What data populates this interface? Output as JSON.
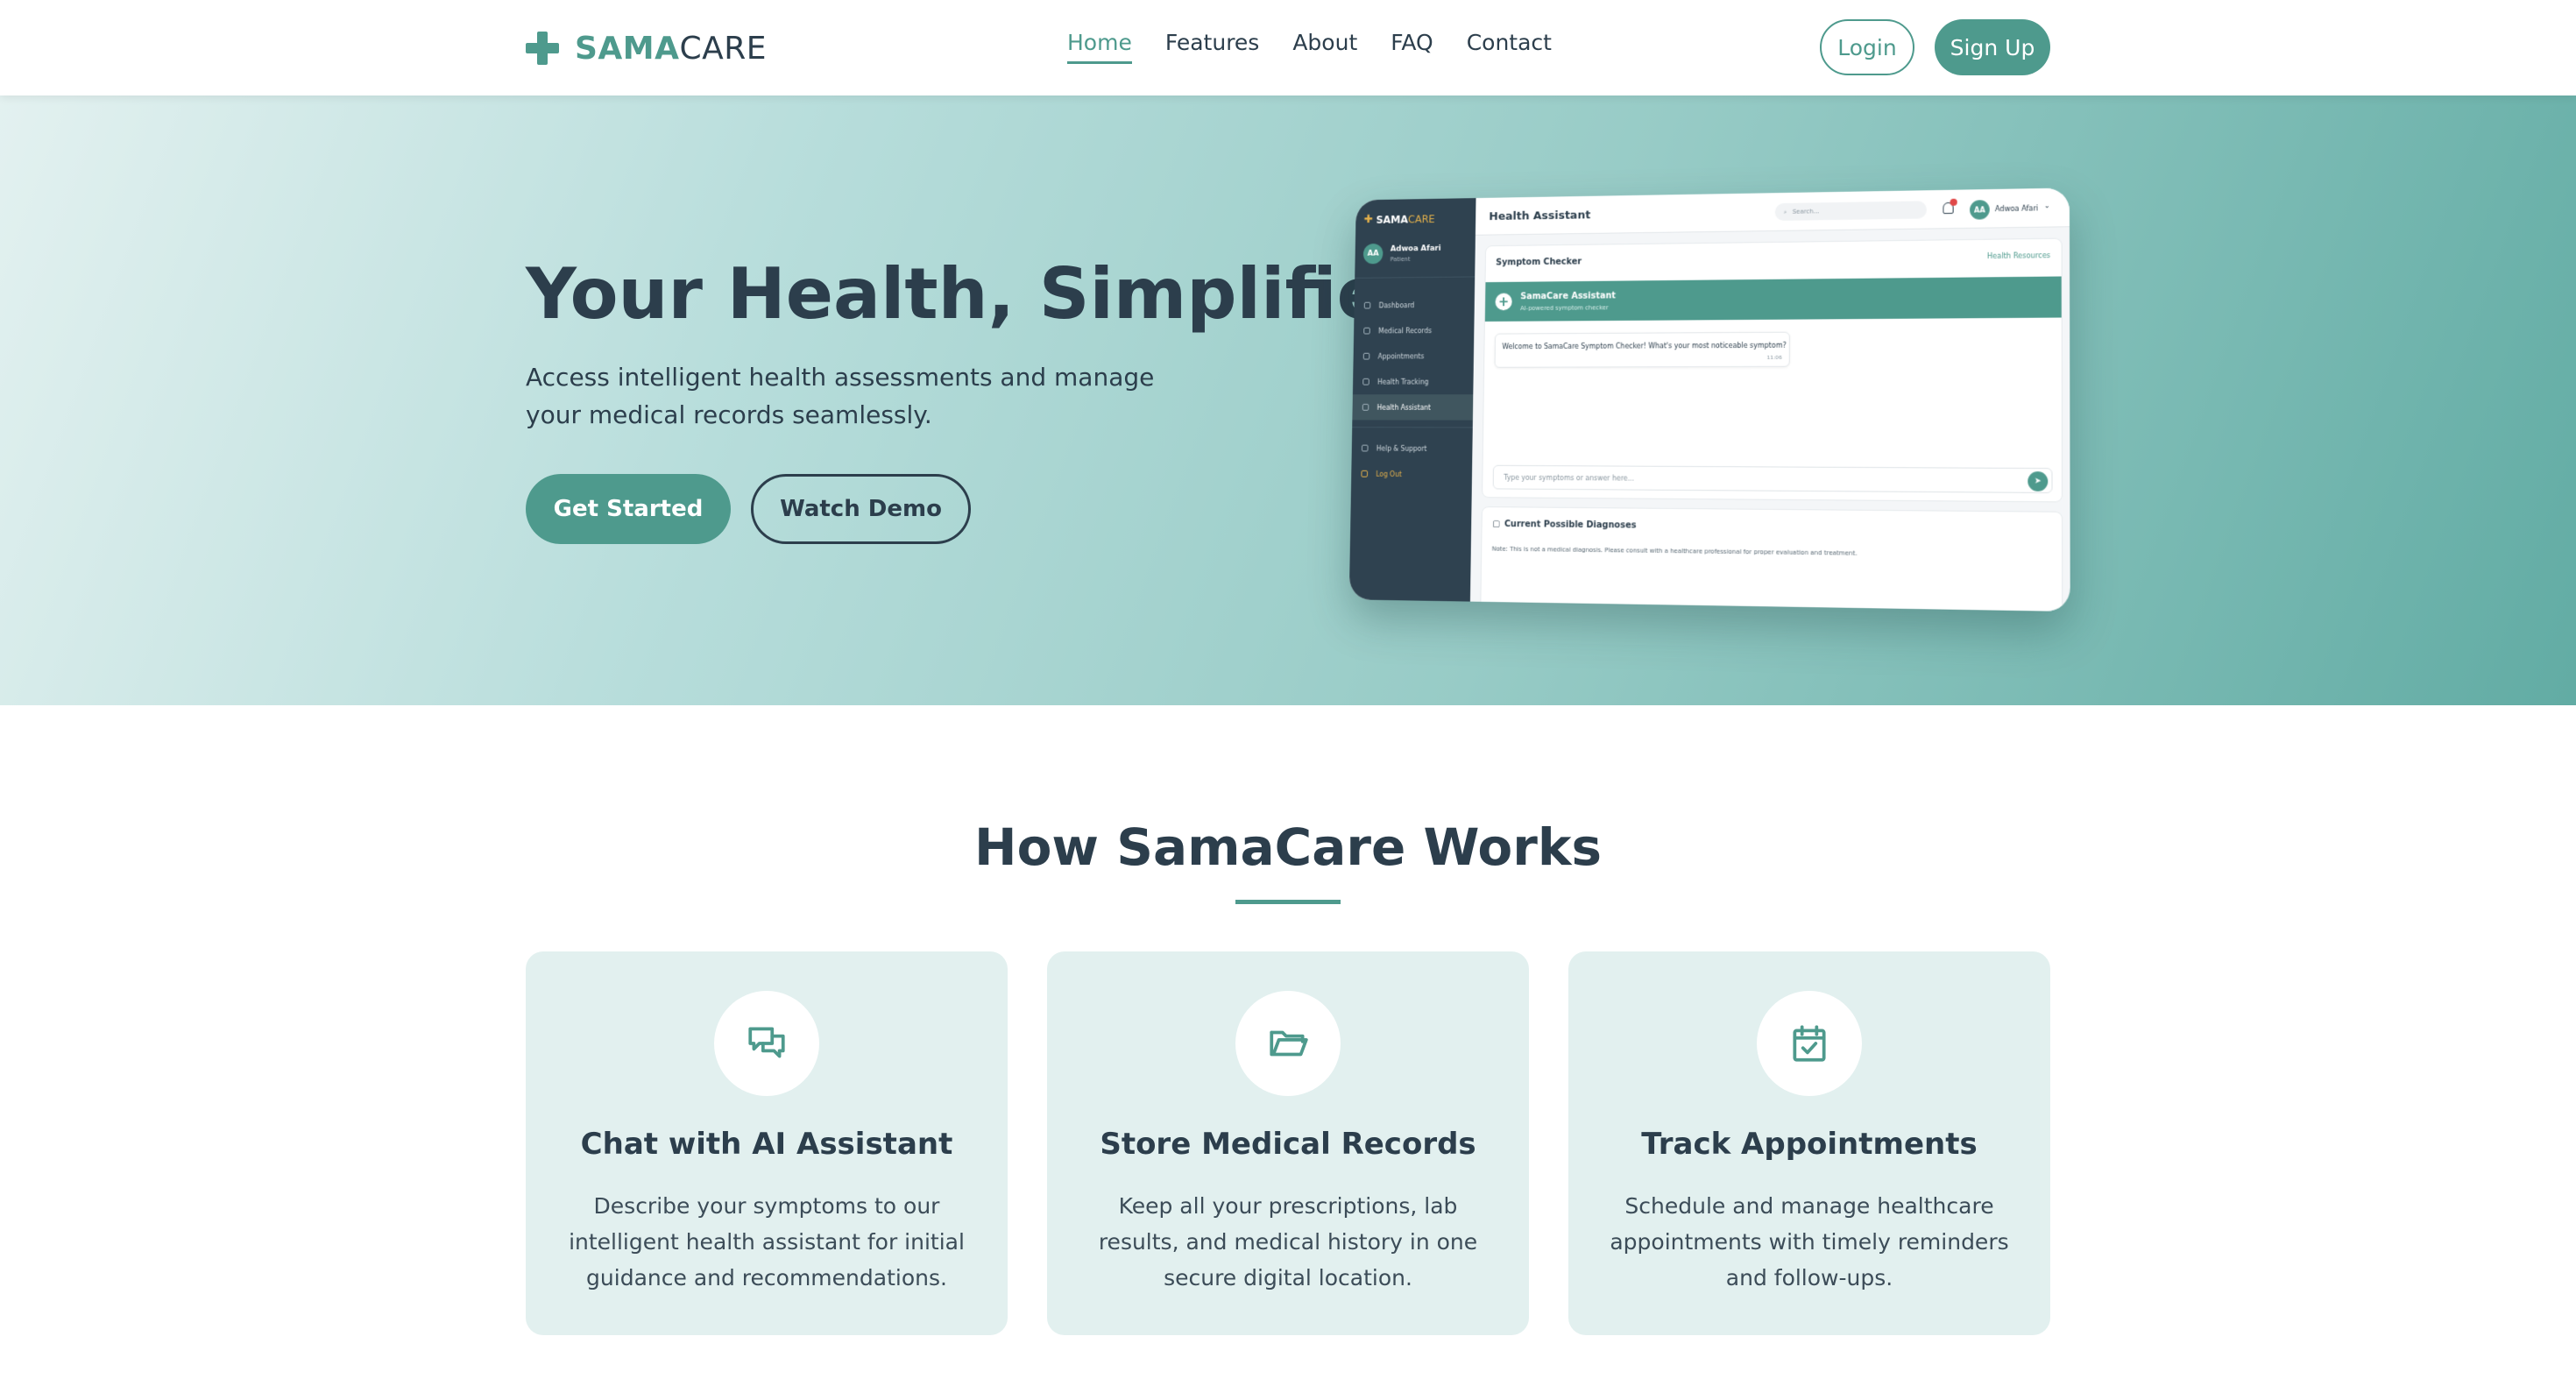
{
  "brand": {
    "name_part1": "SAMA",
    "name_part2": "CARE",
    "accent": "#4e9a8d",
    "dark": "#2c3e4c"
  },
  "nav": {
    "links": [
      {
        "label": "Home",
        "active": true
      },
      {
        "label": "Features",
        "active": false
      },
      {
        "label": "About",
        "active": false
      },
      {
        "label": "FAQ",
        "active": false
      },
      {
        "label": "Contact",
        "active": false
      }
    ],
    "login_label": "Login",
    "signup_label": "Sign Up"
  },
  "hero": {
    "title": "Your Health, Simplified",
    "subtitle": "Access intelligent health assessments and manage your medical records seamlessly.",
    "primary_cta": "Get Started",
    "secondary_cta": "Watch Demo"
  },
  "mockup": {
    "logo_part1": "SAMA",
    "logo_part2": "CARE",
    "user_initials": "AA",
    "user_name": "Adwoa Afari",
    "user_role": "Patient",
    "menu": [
      {
        "label": "Dashboard",
        "icon": "home-icon",
        "active": false
      },
      {
        "label": "Medical Records",
        "icon": "folder-icon",
        "active": false
      },
      {
        "label": "Appointments",
        "icon": "calendar-icon",
        "active": false
      },
      {
        "label": "Health Tracking",
        "icon": "chart-icon",
        "active": false
      },
      {
        "label": "Health Assistant",
        "icon": "chat-icon",
        "active": true
      }
    ],
    "menu_bottom": [
      {
        "label": "Help & Support",
        "icon": "help-icon"
      },
      {
        "label": "Log Out",
        "icon": "logout-icon"
      }
    ],
    "page_title": "Health Assistant",
    "search_placeholder": "Search...",
    "card_title": "Symptom Checker",
    "card_link": "Health Resources",
    "assistant_name": "SamaCare Assistant",
    "assistant_sub": "AI-powered symptom checker",
    "message": "Welcome to SamaCare Symptom Checker! What's your most noticeable symptom?",
    "message_time": "11:06",
    "input_placeholder": "Type your symptoms or answer here...",
    "diagnoses_title": "Current Possible Diagnoses",
    "diagnoses_note": "Note: This is not a medical diagnosis. Please consult with a healthcare professional for proper evaluation and treatment."
  },
  "how": {
    "title": "How SamaCare Works",
    "cards": [
      {
        "icon": "chat-bubbles-icon",
        "title": "Chat with AI Assistant",
        "desc": "Describe your symptoms to our intelligent health assistant for initial guidance and recommendations."
      },
      {
        "icon": "folder-open-icon",
        "title": "Store Medical Records",
        "desc": "Keep all your prescriptions, lab results, and medical history in one secure digital location."
      },
      {
        "icon": "calendar-check-icon",
        "title": "Track Appointments",
        "desc": "Schedule and manage healthcare appointments with timely reminders and follow-ups."
      }
    ]
  }
}
